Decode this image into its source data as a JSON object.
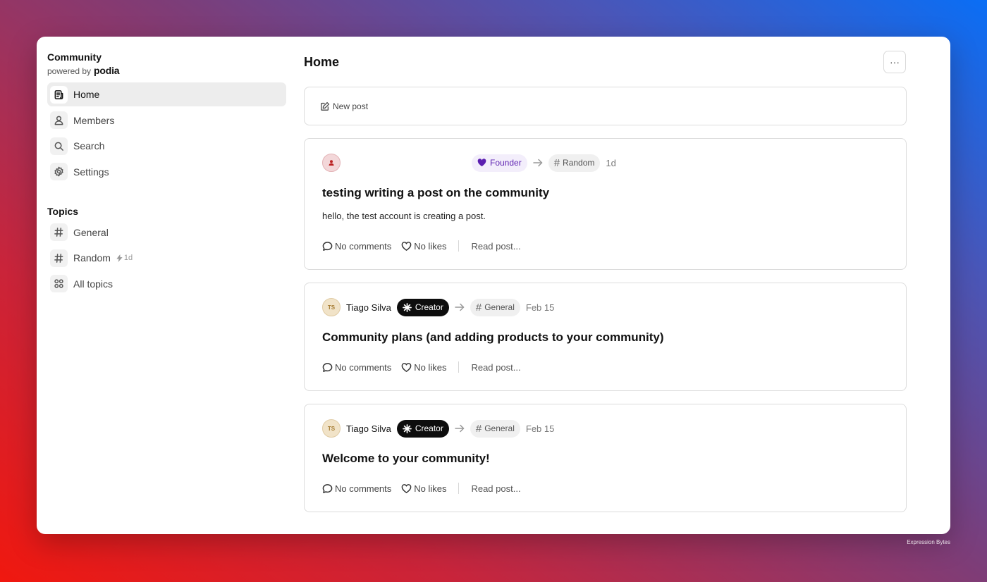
{
  "sidebar": {
    "brand_title": "Community",
    "powered_by": "powered by",
    "brand_logo": "podia",
    "nav": [
      {
        "label": "Home",
        "icon": "document-icon",
        "active": true
      },
      {
        "label": "Members",
        "icon": "person-icon",
        "active": false
      },
      {
        "label": "Search",
        "icon": "search-icon",
        "active": false
      },
      {
        "label": "Settings",
        "icon": "gear-icon",
        "active": false
      }
    ],
    "topics_heading": "Topics",
    "topics": [
      {
        "label": "General",
        "icon": "hash-icon"
      },
      {
        "label": "Random",
        "icon": "hash-icon",
        "meta": "1d"
      },
      {
        "label": "All topics",
        "icon": "grid-icon"
      }
    ]
  },
  "main": {
    "title": "Home",
    "more_label": "···",
    "new_post_label": "New post",
    "posts": [
      {
        "author": "",
        "badge": "Founder",
        "topic": "Random",
        "time": "1d",
        "title": "testing writing a post on the community",
        "body": "hello, the test account is creating a post.",
        "comments": "No comments",
        "likes": "No likes",
        "read": "Read post..."
      },
      {
        "avatar_initials": "TS",
        "author": "Tiago Silva",
        "badge": "Creator",
        "topic": "General",
        "time": "Feb 15",
        "title": "Community plans (and adding products to your community)",
        "comments": "No comments",
        "likes": "No likes",
        "read": "Read post..."
      },
      {
        "avatar_initials": "TS",
        "author": "Tiago Silva",
        "badge": "Creator",
        "topic": "General",
        "time": "Feb 15",
        "title": "Welcome to your community!",
        "comments": "No comments",
        "likes": "No likes",
        "read": "Read post..."
      }
    ]
  },
  "watermark": "Expression Bytes",
  "colors": {
    "founder_badge_bg": "#f3eefb",
    "founder_badge_text": "#5b1fb0",
    "creator_badge_bg": "#0d0d0d",
    "active_nav_bg": "#ededed"
  }
}
